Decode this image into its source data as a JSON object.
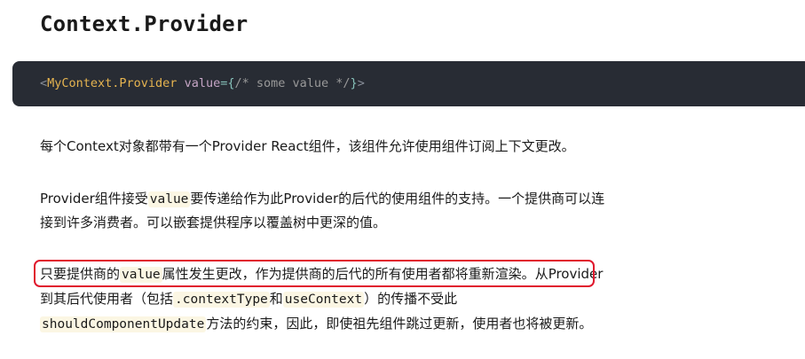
{
  "heading": "Context.Provider",
  "code": {
    "open": "<",
    "tag": "MyContext.Provider",
    "attr": "value",
    "eq_brace_open": "={",
    "comment": "/* some value */",
    "brace_close": "}",
    "close": ">"
  },
  "para1": "每个Context对象都带有一个Provider React组件，该组件允许使用组件订阅上下文更改。",
  "para2": {
    "line1_a": "Provider组件接受",
    "line1_code": "value",
    "line1_b": "要传递给作为此Provider的后代的使用组件的支持。一个提供商可以连",
    "line2": "接到许多消费者。可以嵌套提供程序以覆盖树中更深的值。"
  },
  "para3": {
    "line1_a": "只要提供商的",
    "line1_code": "value",
    "line1_b": "属性发生更改，作为提供商的后代的所有使用者都将重新渲染。",
    "line1_c": "从Provider",
    "line2_a": "到其后代使用者（包括",
    "line2_code1": ".contextType",
    "line2_b": "和",
    "line2_code2": "useContext",
    "line2_c": "）的传播不受此",
    "line3_code": "shouldComponentUpdate",
    "line3_a": "方法的约束，因此，即使祖先组件跳过更新，使用者也将被更新。"
  },
  "colors": {
    "highlight_border": "#e0182d",
    "code_bg": "#282c34",
    "inline_code_bg": "#fbf6e3"
  }
}
